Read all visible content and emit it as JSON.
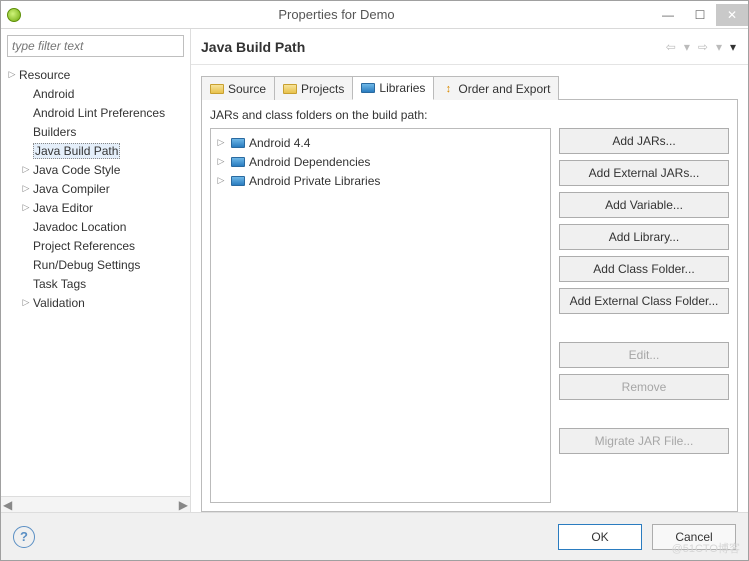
{
  "window": {
    "title": "Properties for Demo",
    "min": "—",
    "max": "☐",
    "close": "✕"
  },
  "filter": {
    "placeholder": "type filter text"
  },
  "navTree": {
    "items": [
      {
        "label": "Resource",
        "expandable": true,
        "level": 0
      },
      {
        "label": "Android",
        "expandable": false,
        "level": 1
      },
      {
        "label": "Android Lint Preferences",
        "expandable": false,
        "level": 1
      },
      {
        "label": "Builders",
        "expandable": false,
        "level": 1
      },
      {
        "label": "Java Build Path",
        "expandable": false,
        "level": 1,
        "selected": true
      },
      {
        "label": "Java Code Style",
        "expandable": true,
        "level": 1
      },
      {
        "label": "Java Compiler",
        "expandable": true,
        "level": 1
      },
      {
        "label": "Java Editor",
        "expandable": true,
        "level": 1
      },
      {
        "label": "Javadoc Location",
        "expandable": false,
        "level": 1
      },
      {
        "label": "Project References",
        "expandable": false,
        "level": 1
      },
      {
        "label": "Run/Debug Settings",
        "expandable": false,
        "level": 1
      },
      {
        "label": "Task Tags",
        "expandable": false,
        "level": 1
      },
      {
        "label": "Validation",
        "expandable": true,
        "level": 1
      }
    ]
  },
  "page": {
    "title": "Java Build Path",
    "tabs": [
      {
        "label": "Source"
      },
      {
        "label": "Projects"
      },
      {
        "label": "Libraries",
        "active": true
      },
      {
        "label": "Order and Export"
      }
    ],
    "description": "JARs and class folders on the build path:",
    "libraries": [
      {
        "label": "Android 4.4"
      },
      {
        "label": "Android Dependencies"
      },
      {
        "label": "Android Private Libraries"
      }
    ],
    "buttons": {
      "addJars": "Add JARs...",
      "addExternalJars": "Add External JARs...",
      "addVariable": "Add Variable...",
      "addLibrary": "Add Library...",
      "addClassFolder": "Add Class Folder...",
      "addExternalClassFolder": "Add External Class Folder...",
      "edit": "Edit...",
      "remove": "Remove",
      "migrate": "Migrate JAR File..."
    }
  },
  "footer": {
    "ok": "OK",
    "cancel": "Cancel"
  },
  "watermark": "@51CTO博客"
}
